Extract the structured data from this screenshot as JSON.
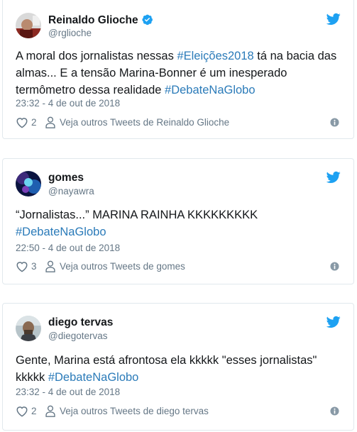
{
  "colors": {
    "twitter_blue": "#1da1f2",
    "hashtag": "#2b7bb9",
    "secondary_text": "#657786",
    "primary_text": "#14171a",
    "border": "#e1e8ed"
  },
  "icons": {
    "brand": "twitter-bird-icon",
    "verified": "verified-badge-icon",
    "like": "heart-icon",
    "profile": "person-icon",
    "info": "info-icon"
  },
  "tweets": [
    {
      "author_name": "Reinaldo Glioche",
      "handle": "@rglioche",
      "verified": true,
      "text_parts": [
        "A moral dos jornalistas nessas ",
        "#Eleições2018",
        " tá na bacia das almas... E a tensão Marina-Bonner é um inesperado termômetro dessa realidade ",
        "#DebateNaGlobo"
      ],
      "timestamp": "23:32 - 4 de out de 2018",
      "likes": "2",
      "more_tweets_label": "Veja outros Tweets de Reinaldo Glioche"
    },
    {
      "author_name": "gomes",
      "handle": "@nayawra",
      "verified": false,
      "text_parts": [
        "“Jornalistas...” MARINA RAINHA KKKKKKKKK",
        "#DebateNaGlobo"
      ],
      "timestamp": "22:50 - 4 de out de 2018",
      "likes": "3",
      "more_tweets_label": "Veja outros Tweets de gomes"
    },
    {
      "author_name": "diego tervas",
      "handle": "@diegotervas",
      "verified": false,
      "text_parts": [
        "Gente, Marina está afrontosa ela  kkkkk \"esses jornalistas\" kkkkk ",
        "#DebateNaGlobo"
      ],
      "timestamp": "23:32 - 4 de out de 2018",
      "likes": "2",
      "more_tweets_label": "Veja outros Tweets de diego tervas"
    }
  ]
}
